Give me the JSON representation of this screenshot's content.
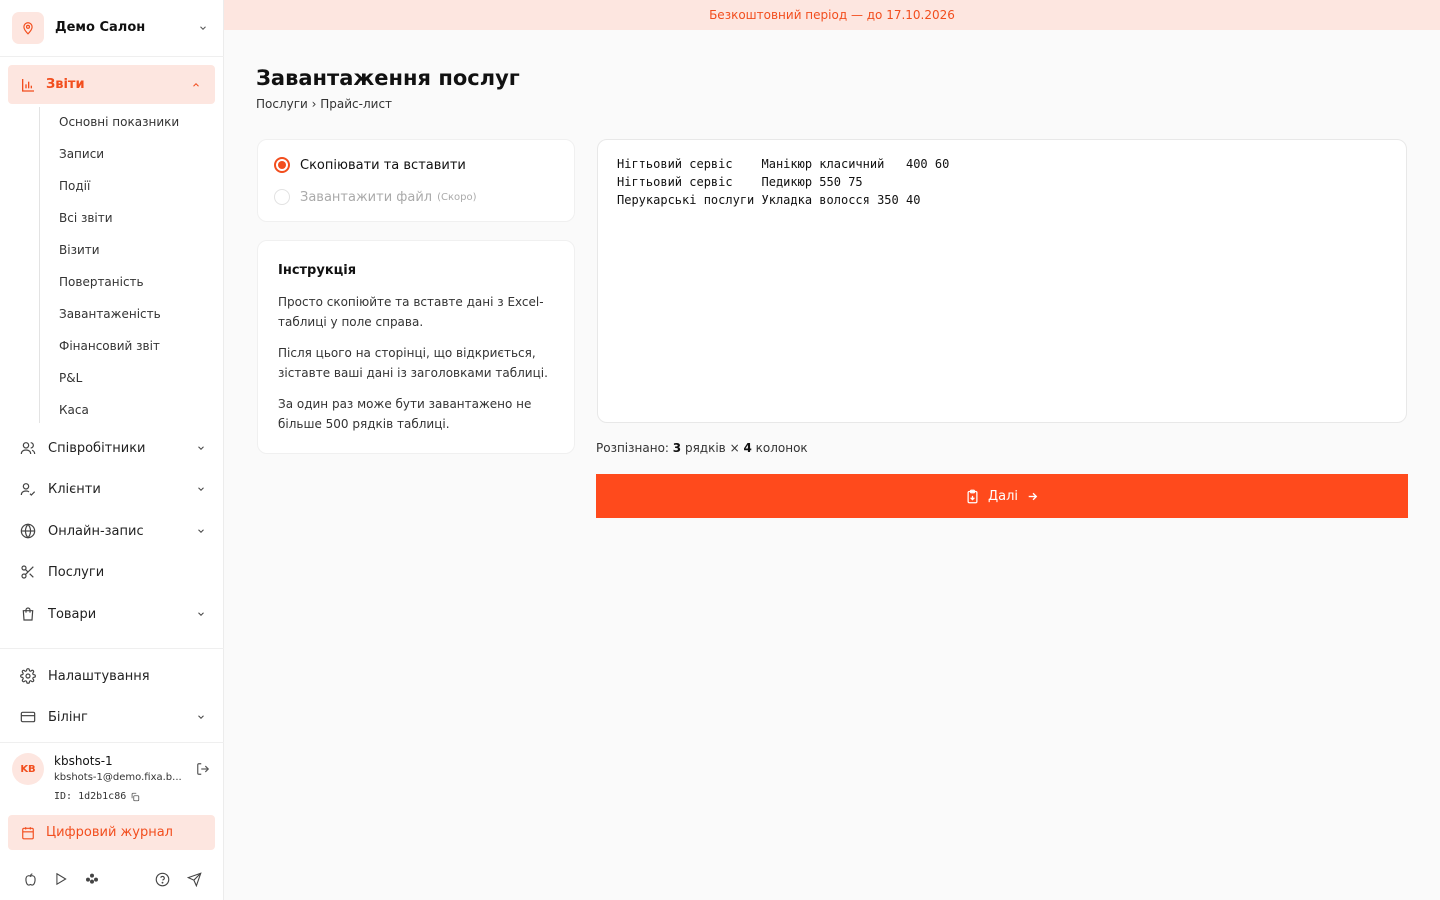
{
  "sidebar": {
    "salon_name": "Демо Салон",
    "reports_label": "Звіти",
    "report_items": [
      "Основні показники",
      "Записи",
      "Події",
      "Всі звіти",
      "Візити",
      "Повертаність",
      "Завантаженість",
      "Фінансовий звіт",
      "P&L",
      "Каса"
    ],
    "employees_label": "Співробітники",
    "clients_label": "Клієнти",
    "online_label": "Онлайн-запис",
    "services_label": "Послуги",
    "goods_label": "Товари",
    "settings_label": "Налаштування",
    "billing_label": "Білінг",
    "user": {
      "initials": "KB",
      "name": "kbshots-1",
      "email": "kbshots-1@demo.fixa.b...",
      "id": "ID: 1d2b1c86"
    },
    "journal_label": "Цифровий журнал"
  },
  "banner": "Безкоштовний період — до 17.10.2026",
  "main": {
    "title": "Завантаження послуг",
    "breadcrumb": "Послуги › Прайс-лист",
    "option_paste": "Скопіювати та вставити",
    "option_file": "Завантажити файл",
    "option_file_badge": "(Скоро)",
    "instr_title": "Інструкція",
    "instr_p1": "Просто скопіюйте та вставте дані з Excel-таблиці у поле справа.",
    "instr_p2": "Після цього на сторінці, що відкриється, зіставте ваші дані із заголовками таблиці.",
    "instr_p3": "За один раз може бути завантажено не більше 500 рядків таблиці.",
    "textarea_value": "Нігтьовий сервіс    Манікюр класичний   400 60\nНігтьовий сервіс    Педикюр 550 75\nПерукарські послуги Укладка волосся 350 40",
    "recognized_prefix": "Розпізнано:",
    "rows_count": "3",
    "rows_word": "рядків ×",
    "cols_count": "4",
    "cols_word": "колонок",
    "next_label": "Далі"
  },
  "colors": {
    "accent": "#f24e1e",
    "button": "#ff4a1c",
    "accent_bg": "#fde6e0"
  }
}
